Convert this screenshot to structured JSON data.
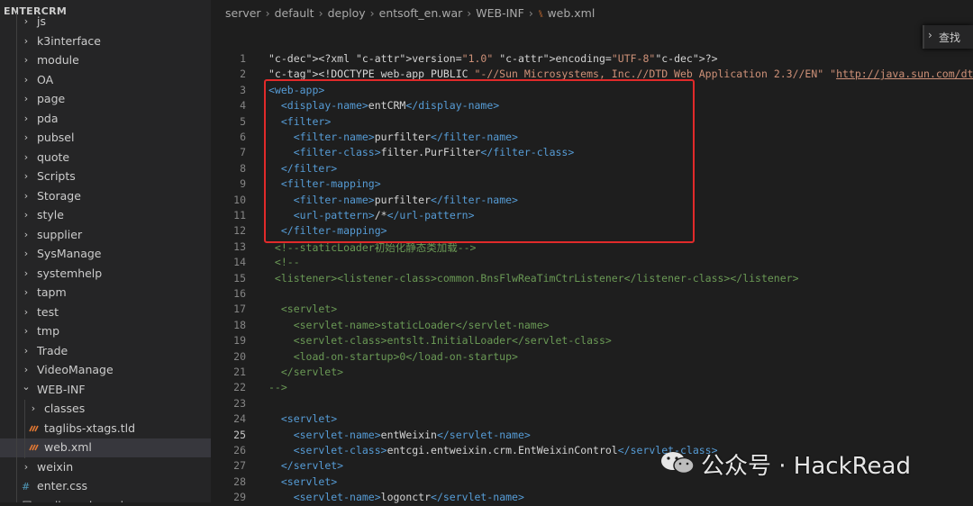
{
  "sidebar": {
    "title": "ENTERCRM",
    "items": [
      {
        "label": "js",
        "type": "folder",
        "expanded": false,
        "depth": 1
      },
      {
        "label": "k3interface",
        "type": "folder",
        "expanded": false,
        "depth": 1
      },
      {
        "label": "module",
        "type": "folder",
        "expanded": false,
        "depth": 1
      },
      {
        "label": "OA",
        "type": "folder",
        "expanded": false,
        "depth": 1
      },
      {
        "label": "page",
        "type": "folder",
        "expanded": false,
        "depth": 1
      },
      {
        "label": "pda",
        "type": "folder",
        "expanded": false,
        "depth": 1
      },
      {
        "label": "pubsel",
        "type": "folder",
        "expanded": false,
        "depth": 1
      },
      {
        "label": "quote",
        "type": "folder",
        "expanded": false,
        "depth": 1
      },
      {
        "label": "Scripts",
        "type": "folder",
        "expanded": false,
        "depth": 1
      },
      {
        "label": "Storage",
        "type": "folder",
        "expanded": false,
        "depth": 1
      },
      {
        "label": "style",
        "type": "folder",
        "expanded": false,
        "depth": 1
      },
      {
        "label": "supplier",
        "type": "folder",
        "expanded": false,
        "depth": 1
      },
      {
        "label": "SysManage",
        "type": "folder",
        "expanded": false,
        "depth": 1
      },
      {
        "label": "systemhelp",
        "type": "folder",
        "expanded": false,
        "depth": 1
      },
      {
        "label": "tapm",
        "type": "folder",
        "expanded": false,
        "depth": 1
      },
      {
        "label": "test",
        "type": "folder",
        "expanded": false,
        "depth": 1
      },
      {
        "label": "tmp",
        "type": "folder",
        "expanded": false,
        "depth": 1
      },
      {
        "label": "Trade",
        "type": "folder",
        "expanded": false,
        "depth": 1
      },
      {
        "label": "VideoManage",
        "type": "folder",
        "expanded": false,
        "depth": 1
      },
      {
        "label": "WEB-INF",
        "type": "folder",
        "expanded": true,
        "depth": 1
      },
      {
        "label": "classes",
        "type": "folder",
        "expanded": false,
        "depth": 2
      },
      {
        "label": "taglibs-xtags.tld",
        "type": "xml-file",
        "depth": 2
      },
      {
        "label": "web.xml",
        "type": "xml-file",
        "depth": 2,
        "selected": true
      },
      {
        "label": "weixin",
        "type": "folder",
        "expanded": false,
        "depth": 1
      },
      {
        "label": "enter.css",
        "type": "css-file",
        "depth": 1
      },
      {
        "label": "mail-send-service",
        "type": "file",
        "depth": 1
      }
    ]
  },
  "breadcrumb": [
    "server",
    "default",
    "deploy",
    "entsoft_en.war",
    "WEB-INF",
    "web.xml"
  ],
  "find_widget": {
    "label": "查找"
  },
  "editor": {
    "active_line": 25,
    "lines": [
      {
        "n": "1",
        "t": "<?xml version=\"1.0\" encoding=\"UTF-8\"?>"
      },
      {
        "n": "2",
        "t": "<!DOCTYPE web-app PUBLIC \"-//Sun Microsystems, Inc.//DTD Web Application 2.3//EN\" \"http://java.sun.com/dtd/web-"
      },
      {
        "n": "3",
        "t": "<web-app>"
      },
      {
        "n": "4",
        "t": "  <display-name>entCRM</display-name>"
      },
      {
        "n": "5",
        "t": "  <filter>"
      },
      {
        "n": "6",
        "t": "    <filter-name>purfilter</filter-name>"
      },
      {
        "n": "7",
        "t": "    <filter-class>filter.PurFilter</filter-class>"
      },
      {
        "n": "8",
        "t": "  </filter>"
      },
      {
        "n": "9",
        "t": "  <filter-mapping>"
      },
      {
        "n": "10",
        "t": "    <filter-name>purfilter</filter-name>"
      },
      {
        "n": "11",
        "t": "    <url-pattern>/*</url-pattern>"
      },
      {
        "n": "12",
        "t": "  </filter-mapping>"
      },
      {
        "n": "13",
        "t": " <!--staticLoader初始化静态类加载-->"
      },
      {
        "n": "14",
        "t": " <!--"
      },
      {
        "n": "15",
        "t": " <listener><listener-class>common.BnsFlwReaTimCtrListener</listener-class></listener>"
      },
      {
        "n": "16",
        "t": ""
      },
      {
        "n": "17",
        "t": "  <servlet>"
      },
      {
        "n": "18",
        "t": "    <servlet-name>staticLoader</servlet-name>"
      },
      {
        "n": "19",
        "t": "    <servlet-class>entslt.InitialLoader</servlet-class>"
      },
      {
        "n": "20",
        "t": "    <load-on-startup>0</load-on-startup>"
      },
      {
        "n": "21",
        "t": "  </servlet>"
      },
      {
        "n": "22",
        "t": "-->"
      },
      {
        "n": "23",
        "t": ""
      },
      {
        "n": "24",
        "t": "  <servlet>"
      },
      {
        "n": "25",
        "t": "    <servlet-name>entWeixin</servlet-name>"
      },
      {
        "n": "26",
        "t": "    <servlet-class>entcgi.entweixin.crm.EntWeixinControl</servlet-class>"
      },
      {
        "n": "27",
        "t": "  </servlet>"
      },
      {
        "n": "28",
        "t": "  <servlet>"
      },
      {
        "n": "29",
        "t": "    <servlet-name>logonctr</servlet-name>"
      }
    ]
  },
  "watermark": "公众号 · HackRead",
  "colors": {
    "highlight_box": "#e12a2a",
    "tag": "#569cd6",
    "attr": "#9cdcfe",
    "string": "#ce9178",
    "comment": "#6a9955"
  }
}
